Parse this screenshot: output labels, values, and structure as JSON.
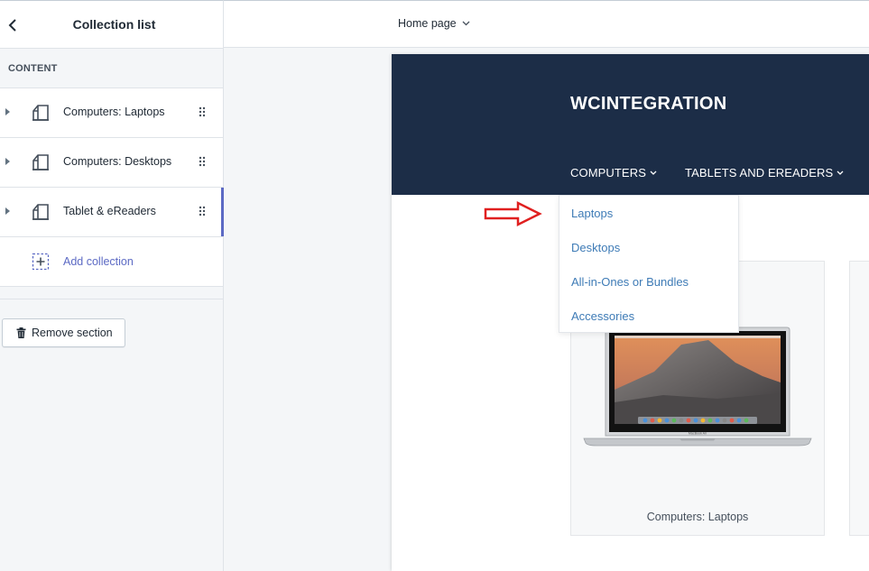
{
  "sidebar": {
    "title": "Collection list",
    "section_label": "CONTENT",
    "items": [
      {
        "label": "Computers: Laptops"
      },
      {
        "label": "Computers: Desktops"
      },
      {
        "label": "Tablet & eReaders"
      }
    ],
    "add_label": "Add collection",
    "remove_label": "Remove section"
  },
  "topbar": {
    "page_select": "Home page"
  },
  "preview": {
    "store_name": "WCINTEGRATION",
    "nav": [
      {
        "label": "COMPUTERS"
      },
      {
        "label": "TABLETS AND EREADERS"
      }
    ],
    "dropdown": [
      {
        "label": "Laptops"
      },
      {
        "label": "Desktops"
      },
      {
        "label": "All-in-Ones or Bundles"
      },
      {
        "label": "Accessories"
      }
    ],
    "card_caption": "Computers: Laptops",
    "laptop_brand": "MacBook Air"
  },
  "colors": {
    "accent": "#5c6ac4",
    "header_bg": "#1c2d47",
    "link": "#3e7bb6",
    "annotation_arrow": "#e02020"
  },
  "icons": {
    "back": "chevron-left-icon",
    "collection": "collection-icon",
    "drag": "drag-handle-icon",
    "add": "add-collection-icon",
    "remove": "trash-icon",
    "dropdown": "chevron-down-icon"
  }
}
